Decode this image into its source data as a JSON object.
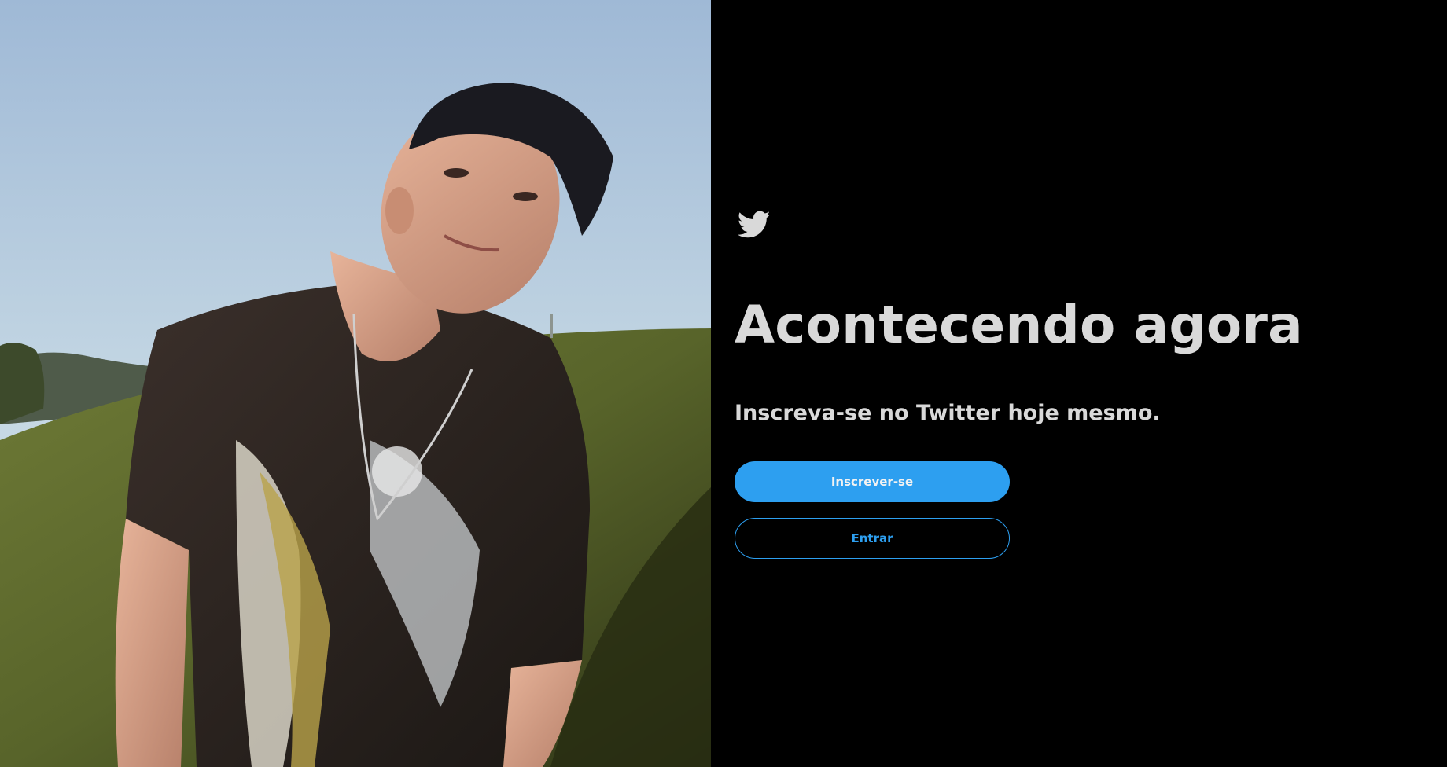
{
  "photo": {
    "description_icon": "profile-photo"
  },
  "logo": {
    "icon": "twitter-bird-icon",
    "color": "#d9d9d9"
  },
  "headline": "Acontecendo agora",
  "subheadline": "Inscreva-se no Twitter hoje mesmo.",
  "buttons": {
    "signup_label": "Inscrever-se",
    "login_label": "Entrar"
  },
  "colors": {
    "background": "#000000",
    "accent": "#2d9ff0",
    "text": "#d9d9d9"
  }
}
